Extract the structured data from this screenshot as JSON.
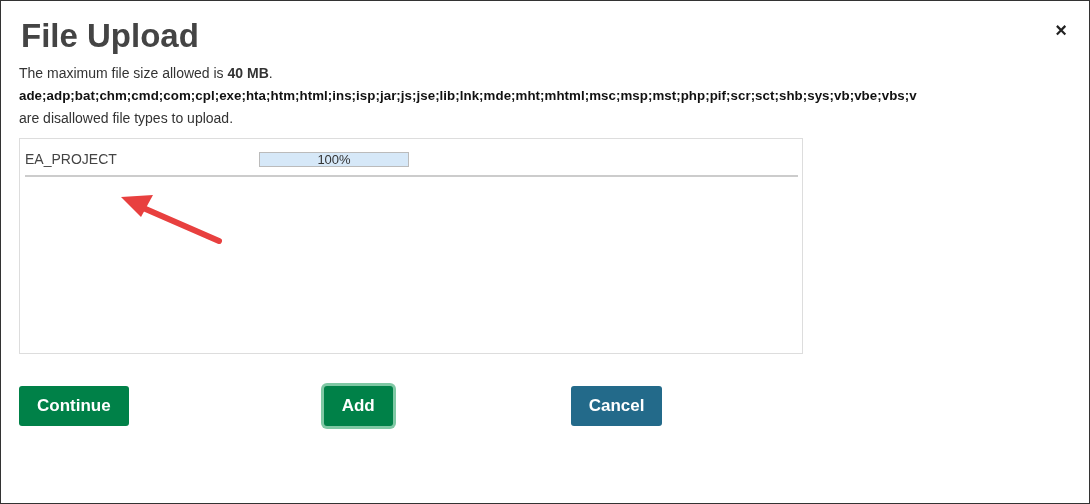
{
  "dialog": {
    "title": "File Upload",
    "close": "×",
    "size_note": "The maximum file size allowed is **40 MB**.",
    "disallowed_types": "ade;adp;bat;chm;cmd;com;cpl;exe;hta;htm;html;ins;isp;jar;js;jse;lib;lnk;mde;mht;mhtml;msc;msp;mst;php;pif;scr;sct;shb;sys;vb;vbe;vbs;v",
    "disallowed_note": "are disallowed file types to upload."
  },
  "files": [
    {
      "name": "EA_PROJECT",
      "level": 1,
      "reading": "100%"
    }
  ],
  "buttons": [
    {
      "label": "Continue",
      "kind": "primary",
      "focused": false
    },
    {
      "label": "Add",
      "kind": "primary",
      "focused": true
    },
    {
      "label": "Cancel",
      "kind": "secondary",
      "focused": false
    }
  ]
}
